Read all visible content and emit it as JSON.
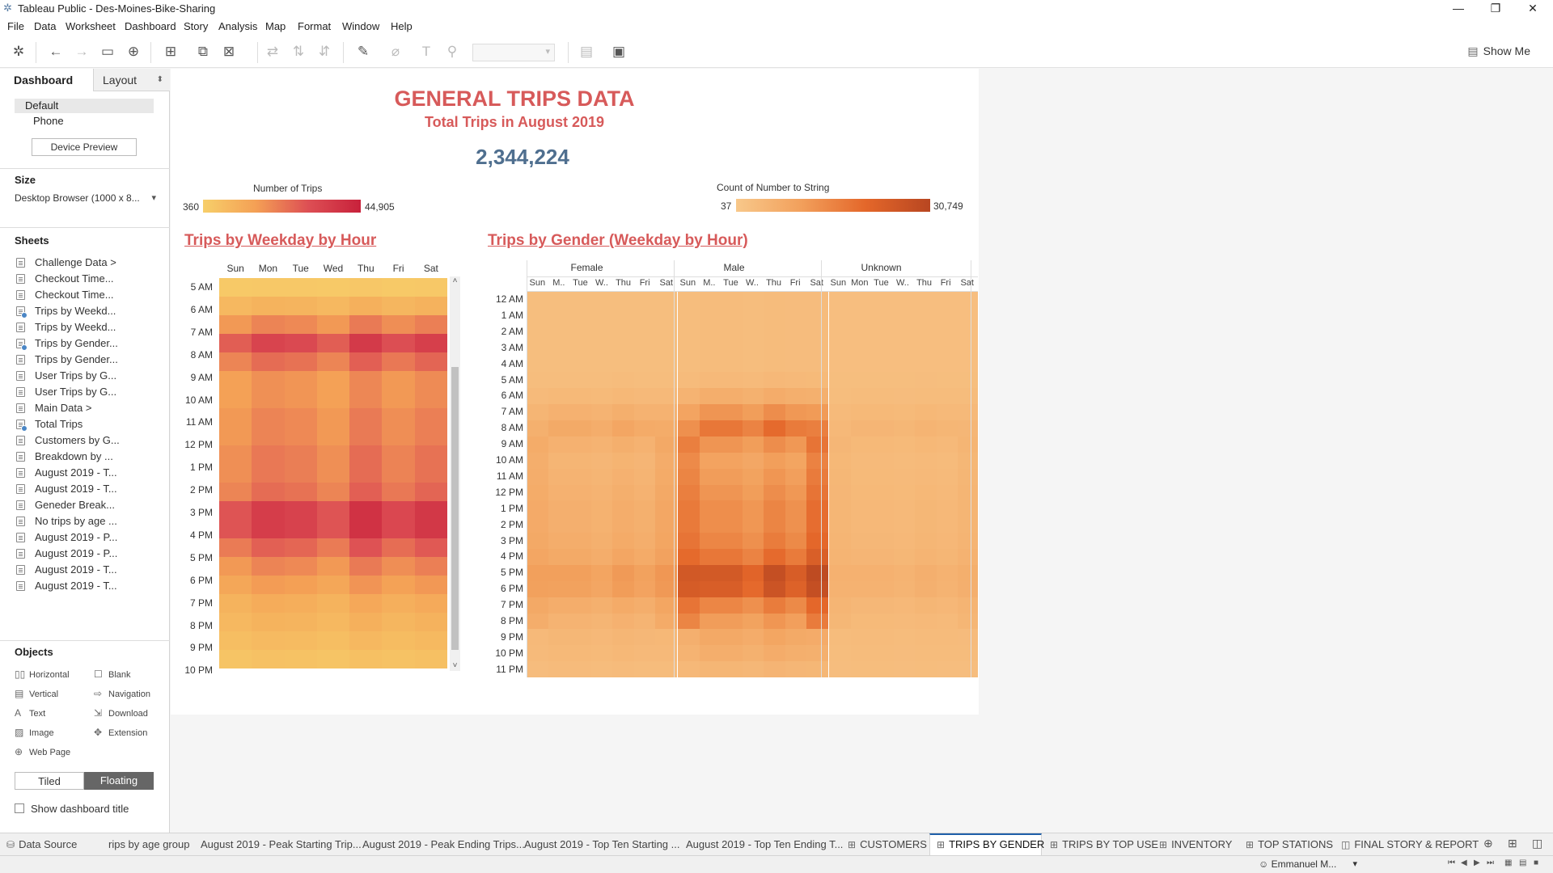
{
  "window": {
    "title": "Tableau Public - Des-Moines-Bike-Sharing"
  },
  "menu": [
    "File",
    "Data",
    "Worksheet",
    "Dashboard",
    "Story",
    "Analysis",
    "Map",
    "Format",
    "Window",
    "Help"
  ],
  "toolbar": {
    "show_me": "Show Me"
  },
  "left_panel": {
    "tabs": {
      "dashboard": "Dashboard",
      "layout": "Layout"
    },
    "devices": {
      "default": "Default",
      "phone": "Phone",
      "preview_button": "Device Preview"
    },
    "size": {
      "heading": "Size",
      "value": "Desktop Browser (1000 x 8..."
    },
    "sheets_heading": "Sheets",
    "sheets": [
      {
        "label": "Challenge Data >",
        "used": false
      },
      {
        "label": "Checkout Time...",
        "used": false
      },
      {
        "label": "Checkout Time...",
        "used": false
      },
      {
        "label": "Trips by Weekd...",
        "used": true
      },
      {
        "label": "Trips by Weekd...",
        "used": false
      },
      {
        "label": "Trips by Gender...",
        "used": true
      },
      {
        "label": "Trips by Gender...",
        "used": false
      },
      {
        "label": "User Trips by G...",
        "used": false
      },
      {
        "label": "User Trips by G...",
        "used": false
      },
      {
        "label": "Main Data >",
        "used": false
      },
      {
        "label": "Total Trips",
        "used": true
      },
      {
        "label": "Customers by G...",
        "used": false
      },
      {
        "label": "Breakdown by ...",
        "used": false
      },
      {
        "label": "August 2019 - T...",
        "used": false
      },
      {
        "label": "August 2019 - T...",
        "used": false
      },
      {
        "label": "Geneder Break...",
        "used": false
      },
      {
        "label": "No trips by age ...",
        "used": false
      },
      {
        "label": "August 2019 - P...",
        "used": false
      },
      {
        "label": "August 2019 - P...",
        "used": false
      },
      {
        "label": "August 2019 - T...",
        "used": false
      },
      {
        "label": "August 2019 - T...",
        "used": false
      }
    ],
    "objects_heading": "Objects",
    "objects": {
      "horizontal": "Horizontal",
      "blank": "Blank",
      "vertical": "Vertical",
      "navigation": "Navigation",
      "text": "Text",
      "download": "Download",
      "image": "Image",
      "extension": "Extension",
      "web_page": "Web Page"
    },
    "tiled": "Tiled",
    "floating": "Floating",
    "show_title": "Show dashboard title"
  },
  "dashboard": {
    "title": "GENERAL TRIPS DATA",
    "subtitle": "Total Trips in August 2019",
    "total": "2,344,224",
    "legend1": {
      "title": "Number of Trips",
      "min": "360",
      "max": "44,905",
      "colors": [
        "#f7cf6a",
        "#f4a055",
        "#dd4f54",
        "#c8213b"
      ]
    },
    "legend2": {
      "title": "Count of Number to String",
      "min": "37",
      "max": "30,749",
      "colors": [
        "#f8c88a",
        "#f2a05c",
        "#e4672a",
        "#b84621"
      ]
    },
    "chart1": {
      "title": "Trips by Weekday by Hour",
      "days": [
        "Sun",
        "Mon",
        "Tue",
        "Wed",
        "Thu",
        "Fri",
        "Sat"
      ],
      "hours": [
        "5 AM",
        "6 AM",
        "7 AM",
        "8 AM",
        "9 AM",
        "10 AM",
        "11 AM",
        "12 PM",
        "1 PM",
        "2 PM",
        "3 PM",
        "4 PM",
        "5 PM",
        "6 PM",
        "7 PM",
        "8 PM",
        "9 PM",
        "10 PM"
      ]
    },
    "chart2": {
      "title": "Trips by Gender  (Weekday by Hour)",
      "genders": [
        "Female",
        "Male",
        "Unknown"
      ],
      "day_labels": [
        "Sun",
        "M..",
        "Tue",
        "W..",
        "Thu",
        "Fri",
        "Sat",
        "Sun",
        "M..",
        "Tue",
        "W..",
        "Thu",
        "Fri",
        "Sat",
        "Sun",
        "Mon",
        "Tue",
        "W..",
        "Thu",
        "Fri",
        "Sat"
      ],
      "hours": [
        "12 AM",
        "1 AM",
        "2 AM",
        "3 AM",
        "4 AM",
        "5 AM",
        "6 AM",
        "7 AM",
        "8 AM",
        "9 AM",
        "10 AM",
        "11 AM",
        "12 PM",
        "1 PM",
        "2 PM",
        "3 PM",
        "4 PM",
        "5 PM",
        "6 PM",
        "7 PM",
        "8 PM",
        "9 PM",
        "10 PM",
        "11 PM"
      ]
    }
  },
  "tabs": [
    {
      "label": "Data Source",
      "icon": "database-icon",
      "active": false
    },
    {
      "label": "rips by age group",
      "icon": "",
      "active": false
    },
    {
      "label": "August 2019 - Peak Starting Trip...",
      "icon": "",
      "active": false
    },
    {
      "label": "August 2019 - Peak Ending Trips...",
      "icon": "",
      "active": false
    },
    {
      "label": "August 2019 - Top Ten Starting ...",
      "icon": "",
      "active": false
    },
    {
      "label": "August 2019 - Top Ten Ending T...",
      "icon": "",
      "active": false
    },
    {
      "label": "CUSTOMERS",
      "icon": "dashboard-icon",
      "active": false
    },
    {
      "label": "TRIPS BY GENDER",
      "icon": "dashboard-icon",
      "active": true
    },
    {
      "label": "TRIPS BY TOP USE",
      "icon": "dashboard-icon",
      "active": false
    },
    {
      "label": "INVENTORY",
      "icon": "dashboard-icon",
      "active": false
    },
    {
      "label": "TOP STATIONS",
      "icon": "dashboard-icon",
      "active": false
    },
    {
      "label": "FINAL STORY & REPORT",
      "icon": "story-icon",
      "active": false
    }
  ],
  "status": {
    "user": "Emmanuel M..."
  }
}
